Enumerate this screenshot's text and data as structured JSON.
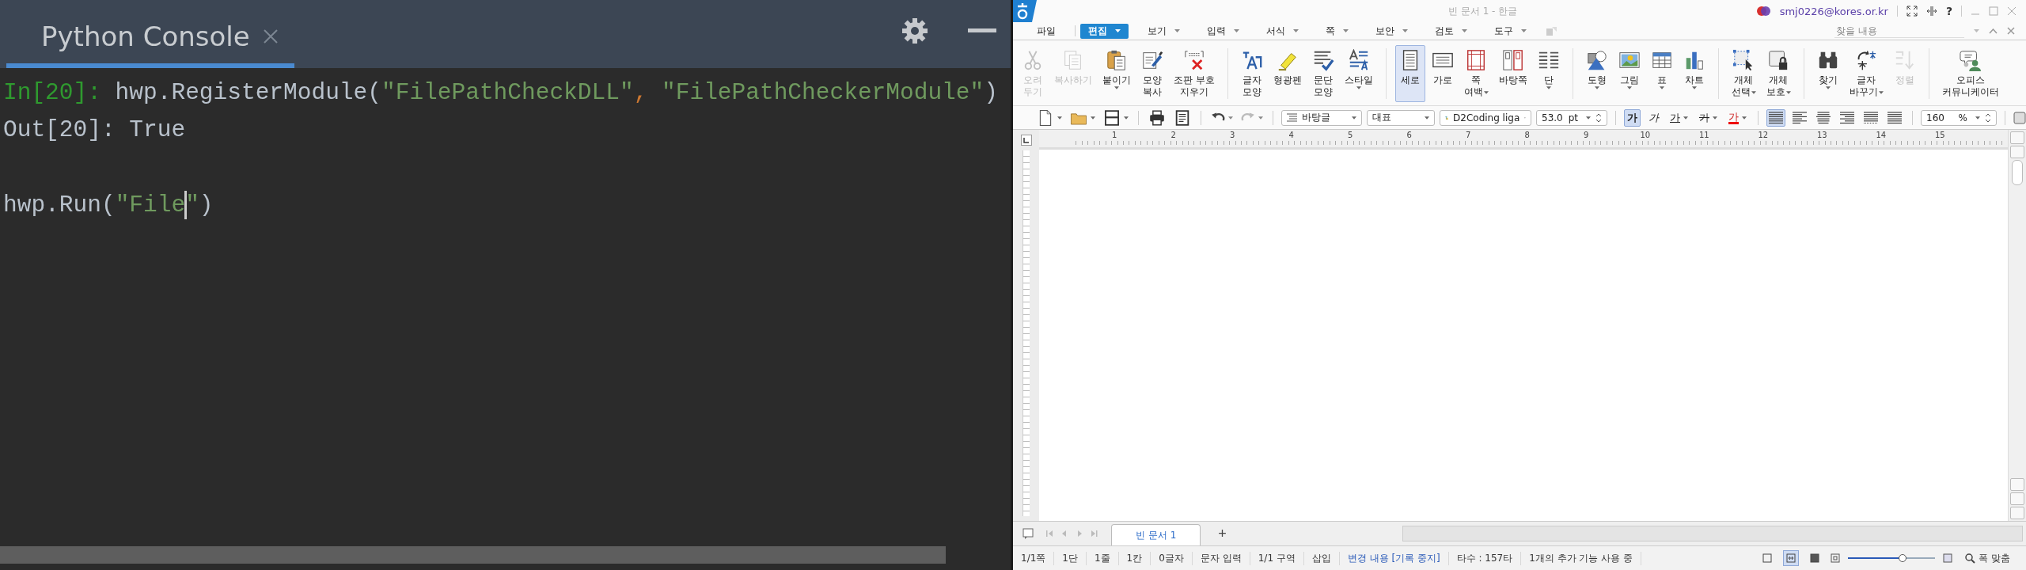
{
  "console": {
    "title": "Python Console",
    "lines": [
      {
        "gap_before": false,
        "segments": [
          {
            "kind": "prompt",
            "text": "In[20]:"
          },
          {
            "kind": "code",
            "text": " hwp.RegisterModule("
          },
          {
            "kind": "string",
            "text": "\"FilePathCheckDLL\""
          },
          {
            "kind": "punct",
            "text": ","
          },
          {
            "kind": "string",
            "text": " \"FilePathCheckerModule\""
          },
          {
            "kind": "code",
            "text": ")"
          }
        ]
      },
      {
        "gap_before": false,
        "segments": [
          {
            "kind": "code",
            "text": "Out[20]: True"
          }
        ]
      },
      {
        "gap_before": true,
        "segments": [
          {
            "kind": "code",
            "text": "hwp.Run("
          },
          {
            "kind": "string",
            "text": "\"File"
          },
          {
            "kind": "cursor"
          },
          {
            "kind": "string",
            "text": "\""
          },
          {
            "kind": "code",
            "text": ")"
          }
        ]
      }
    ]
  },
  "hwp": {
    "title": "빈 문서 1 - 한글",
    "account": "smj0226@kores.or.kr",
    "help": "?",
    "search": {
      "placeholder": "찾을 내용"
    },
    "menus": [
      {
        "label": "파일",
        "selected": false,
        "caret": false
      },
      {
        "label": "편집",
        "selected": true,
        "caret": true
      },
      {
        "label": "보기",
        "selected": false,
        "caret": true
      },
      {
        "label": "입력",
        "selected": false,
        "caret": true
      },
      {
        "label": "서식",
        "selected": false,
        "caret": true
      },
      {
        "label": "쪽",
        "selected": false,
        "caret": true
      },
      {
        "label": "보안",
        "selected": false,
        "caret": true
      },
      {
        "label": "검토",
        "selected": false,
        "caret": true
      },
      {
        "label": "도구",
        "selected": false,
        "caret": true
      }
    ],
    "ribbon": {
      "groups": [
        {
          "items": [
            {
              "lines": [
                "오려",
                "두기"
              ],
              "disabled": true,
              "selected": false
            },
            {
              "lines": [
                "복사하기"
              ],
              "disabled": true,
              "selected": false
            },
            {
              "lines": [
                "붙이기"
              ],
              "disabled": false,
              "selected": false,
              "caret": true,
              "caret_below": true
            },
            {
              "lines": [
                "모양",
                "복사"
              ],
              "disabled": false,
              "selected": false
            },
            {
              "lines": [
                "조판 부호",
                "지우기"
              ],
              "disabled": false,
              "selected": false
            }
          ]
        },
        {
          "items": [
            {
              "lines": [
                "글자",
                "모양"
              ],
              "disabled": false,
              "selected": false
            },
            {
              "lines": [
                "형광펜"
              ],
              "disabled": false,
              "selected": false
            },
            {
              "lines": [
                "문단",
                "모양"
              ],
              "disabled": false,
              "selected": false
            },
            {
              "lines": [
                "스타일"
              ],
              "disabled": false,
              "selected": false,
              "caret": true,
              "caret_below": true
            }
          ]
        },
        {
          "items": [
            {
              "lines": [
                "세로"
              ],
              "disabled": false,
              "selected": true
            },
            {
              "lines": [
                "가로"
              ],
              "disabled": false,
              "selected": false
            },
            {
              "lines": [
                "쪽",
                "여백"
              ],
              "disabled": false,
              "selected": false,
              "caret": true,
              "caret_below": false
            },
            {
              "lines": [
                "바탕쪽"
              ],
              "disabled": false,
              "selected": false
            },
            {
              "lines": [
                "단"
              ],
              "disabled": false,
              "selected": false,
              "caret": true,
              "caret_below": true
            }
          ]
        },
        {
          "items": [
            {
              "lines": [
                "도형"
              ],
              "disabled": false,
              "selected": false,
              "caret": true,
              "caret_below": true
            },
            {
              "lines": [
                "그림"
              ],
              "disabled": false,
              "selected": false,
              "caret": true,
              "caret_below": true
            },
            {
              "lines": [
                "표"
              ],
              "disabled": false,
              "selected": false,
              "caret": true,
              "caret_below": true
            },
            {
              "lines": [
                "차트"
              ],
              "disabled": false,
              "selected": false,
              "caret": true,
              "caret_below": true
            }
          ]
        },
        {
          "items": [
            {
              "lines": [
                "개체",
                "선택"
              ],
              "disabled": false,
              "selected": false,
              "caret": true,
              "caret_below": false
            },
            {
              "lines": [
                "개체",
                "보호"
              ],
              "disabled": false,
              "selected": false,
              "caret": true,
              "caret_below": false
            }
          ]
        },
        {
          "items": [
            {
              "lines": [
                "찾기"
              ],
              "disabled": false,
              "selected": false,
              "caret": true,
              "caret_below": true
            },
            {
              "lines": [
                "글자",
                "바꾸기"
              ],
              "disabled": false,
              "selected": false,
              "caret": true,
              "caret_below": false
            },
            {
              "lines": [
                "정렬"
              ],
              "disabled": true,
              "selected": false
            }
          ]
        },
        {
          "items": [
            {
              "lines": [
                "오피스",
                "커뮤니케이터"
              ],
              "disabled": false,
              "selected": false
            }
          ]
        }
      ]
    },
    "format_bar": {
      "style": "바탕글",
      "language": "대표",
      "font": "D2Coding liga",
      "size": "53.0",
      "size_unit": "pt",
      "char_buttons": [
        {
          "label": "가",
          "kind": "bold",
          "selected": true,
          "caret": false
        },
        {
          "label": "가",
          "kind": "italic",
          "selected": false,
          "caret": false
        },
        {
          "label": "가",
          "kind": "underline",
          "selected": false,
          "caret": true
        },
        {
          "label": "가",
          "kind": "strike",
          "selected": false,
          "caret": true
        },
        {
          "label": "가",
          "kind": "color",
          "selected": false,
          "caret": true
        }
      ],
      "align_buttons": [
        {
          "selected": true
        },
        {
          "selected": false
        },
        {
          "selected": false
        },
        {
          "selected": false
        },
        {
          "selected": false
        },
        {
          "selected": false
        }
      ],
      "zoom": "160",
      "zoom_unit": "%"
    },
    "ruler": {
      "labels": [
        "1",
        "2",
        "3",
        "4",
        "5",
        "6",
        "7",
        "8",
        "9",
        "10",
        "11",
        "12",
        "13",
        "14",
        "15"
      ]
    },
    "doc_tabs": [
      {
        "label": "빈 문서 1",
        "selected": true
      }
    ],
    "add_tab": "+",
    "status_bar": {
      "items": [
        {
          "kind": "text",
          "text": "1/1쪽"
        },
        {
          "kind": "text",
          "text": "1단"
        },
        {
          "kind": "text",
          "text": "1줄"
        },
        {
          "kind": "text",
          "text": "1칸"
        },
        {
          "kind": "text",
          "text": "0글자"
        },
        {
          "kind": "text",
          "text": "문자 입력"
        },
        {
          "kind": "text",
          "text": "1/1 구역"
        },
        {
          "kind": "text",
          "text": "삽입"
        },
        {
          "kind": "link",
          "text": "변경 내용 [기록 중지]"
        },
        {
          "kind": "text",
          "text": "타수 : 157타"
        },
        {
          "kind": "text",
          "text": "1개의 추가 기능 사용 중"
        }
      ],
      "views": [
        {
          "selected": false
        },
        {
          "selected": true
        },
        {
          "selected": false
        }
      ],
      "zoom_slider": {
        "level": 0.63
      },
      "fit_button": "폭 맞춤"
    }
  }
}
